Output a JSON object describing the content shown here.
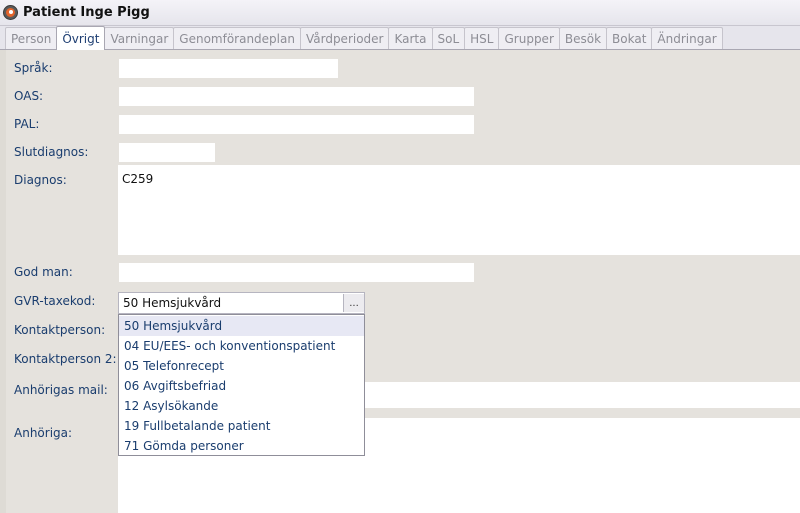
{
  "window": {
    "title": "Patient Inge Pigg"
  },
  "tabs": [
    {
      "label": "Person",
      "active": false
    },
    {
      "label": "Övrigt",
      "active": true
    },
    {
      "label": "Varningar",
      "active": false
    },
    {
      "label": "Genomförandeplan",
      "active": false
    },
    {
      "label": "Vårdperioder",
      "active": false
    },
    {
      "label": "Karta",
      "active": false
    },
    {
      "label": "SoL",
      "active": false
    },
    {
      "label": "HSL",
      "active": false
    },
    {
      "label": "Grupper",
      "active": false
    },
    {
      "label": "Besök",
      "active": false
    },
    {
      "label": "Bokat",
      "active": false
    },
    {
      "label": "Ändringar",
      "active": false
    }
  ],
  "form": {
    "sprak": {
      "label": "Språk:",
      "value": ""
    },
    "oas": {
      "label": "OAS:",
      "value": ""
    },
    "pal": {
      "label": "PAL:",
      "value": ""
    },
    "slutdiagnos": {
      "label": "Slutdiagnos:",
      "value": ""
    },
    "diagnos": {
      "label": "Diagnos:",
      "value": "C259"
    },
    "god_man": {
      "label": "God man:",
      "value": ""
    },
    "gvr_taxekod": {
      "label": "GVR-taxekod:",
      "value": "50 Hemsjukvård",
      "button": "..."
    },
    "kontaktperson": {
      "label": "Kontaktperson:"
    },
    "kontaktperson2": {
      "label": "Kontaktperson 2:"
    },
    "anhorigas_mail": {
      "label": "Anhörigas mail:"
    },
    "anhoriga": {
      "label": "Anhöriga:"
    }
  },
  "dropdown": {
    "options": [
      "50 Hemsjukvård",
      "04 EU/EES- och konventionspatient",
      "05 Telefonrecept",
      "06 Avgiftsbefriad",
      "12 Asylsökande",
      "19 Fullbetalande patient",
      "71 Gömda personer"
    ],
    "selected_index": 0
  }
}
